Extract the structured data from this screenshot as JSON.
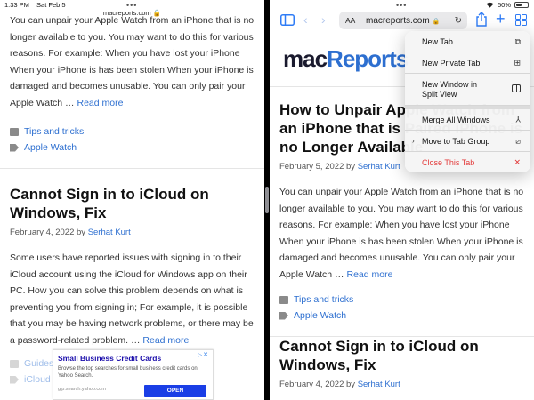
{
  "status_bar": {
    "time": "1:33 PM",
    "date": "Sat Feb 5",
    "battery": "50%"
  },
  "left_pane": {
    "url": "macreports.com",
    "intro_text": "You can unpair your Apple Watch from an iPhone that is no longer available to you. You may want to do this for various reasons. For example: When you have lost your iPhone When your iPhone is has been stolen When your iPhone is damaged and becomes unusable. You can only pair your Apple Watch …",
    "read_more": "Read more",
    "category": "Tips and tricks",
    "tag": "Apple Watch",
    "post": {
      "title": "Cannot Sign in to iCloud on Windows, Fix",
      "date": "February 4, 2022",
      "by": "by",
      "author": "Serhat Kurt",
      "excerpt": "Some users have reported issues with signing in to their iCloud account using the iCloud for Windows app on their PC. How you can solve this problem depends on what is preventing you from signing in; For example, it is possible that you may be having network problems, or there may be a password-related problem. …",
      "read_more": "Read more",
      "category_partial": "Guides",
      "tag_partial": "iCloud"
    },
    "ad": {
      "title": "Small Business Credit Cards",
      "description": "Browse the top searches for small business credit cards on Yahoo Search.",
      "url": "glp.search.yahoo.com",
      "button": "OPEN"
    }
  },
  "right_pane": {
    "url_aa": "AA",
    "url": "macreports.com",
    "logo_mac": "mac",
    "logo_reports": "Reports",
    "post1": {
      "title": "How to Unpair Apple Watch from an iPhone that is Paired iPhone is no Longer Available",
      "date": "February 5, 2022",
      "by": "by",
      "author": "Serhat Kurt",
      "excerpt": "You can unpair your Apple Watch from an iPhone that is no longer available to you. You may want to do this for various reasons. For example: When you have lost your iPhone When your iPhone is has been stolen When your iPhone is damaged and becomes unusable. You can only pair your Apple Watch …",
      "read_more": "Read more",
      "category": "Tips and tricks",
      "tag": "Apple Watch"
    },
    "post2": {
      "title": "Cannot Sign in to iCloud on Windows, Fix",
      "date": "February 4, 2022",
      "by": "by",
      "author": "Serhat Kurt"
    }
  },
  "menu": {
    "items": [
      {
        "label": "New Tab",
        "icon": "new-tab-icon"
      },
      {
        "label": "New Private Tab",
        "icon": "private-tab-icon"
      },
      {
        "label": "New Window in Split View",
        "icon": "split-view-icon"
      },
      {
        "label": "Merge All Windows",
        "icon": "merge-icon"
      },
      {
        "label": "Move to Tab Group",
        "icon": "tab-group-icon"
      },
      {
        "label": "Close This Tab",
        "icon": "close-icon"
      }
    ]
  },
  "colors": {
    "link": "#2d6fd0",
    "accent": "#2f7cf6",
    "destructive": "#e23b3b"
  }
}
